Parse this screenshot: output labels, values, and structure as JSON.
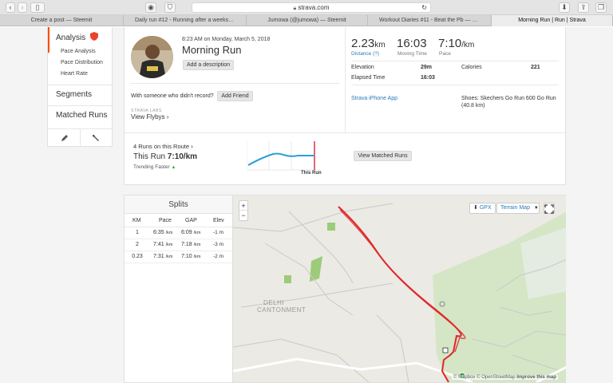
{
  "browser": {
    "url": "strava.com",
    "tabs": [
      {
        "label": "Create a post — Steemit",
        "active": false
      },
      {
        "label": "Daily run #12 - Running after a weeks break (#...",
        "active": false
      },
      {
        "label": "Jumowa (@jumowa) — Steemit",
        "active": false
      },
      {
        "label": "Workout Diaries #11 - Beat the Pb — Steemit",
        "active": false
      },
      {
        "label": "Morning Run | Run | Strava",
        "active": true
      }
    ]
  },
  "sidebar": {
    "analysis_label": "Analysis",
    "sub_items": [
      "Pace Analysis",
      "Pace Distribution",
      "Heart Rate"
    ],
    "segments_label": "Segments",
    "matched_label": "Matched Runs"
  },
  "activity": {
    "datetime": "8:23 AM on Monday, March 5, 2018",
    "title": "Morning Run",
    "add_description": "Add a description",
    "with_someone": "With someone who didn't record?",
    "add_friend": "Add Friend",
    "strava_labs": "STRAVA LABS",
    "view_flybys": "View Flybys"
  },
  "stats": {
    "distance_value": "2.23",
    "distance_unit": "km",
    "distance_label": "Distance (?)",
    "moving_time_value": "16:03",
    "moving_time_label": "Moving Time",
    "pace_value": "7:10",
    "pace_unit": "/km",
    "pace_label": "Pace",
    "elevation_label": "Elevation",
    "elevation_value": "29m",
    "calories_label": "Calories",
    "calories_value": "221",
    "elapsed_label": "Elapsed Time",
    "elapsed_value": "16:03",
    "device": "Strava iPhone App",
    "shoes": "Shoes: Skechers Go Run 600 Go Run",
    "shoes_dist": "(40.8 km)"
  },
  "route": {
    "count_label": "4 Runs on this Route",
    "this_run_prefix": "This Run",
    "this_run_pace": "7:10/km",
    "trend": "Trending Faster",
    "chart_label": "This Run",
    "view_matched": "View Matched Runs",
    "trend_color": "#2a9fd8",
    "marker_color": "#d0021b"
  },
  "splits": {
    "title": "Splits",
    "headers": [
      "KM",
      "Pace",
      "GAP",
      "Elev"
    ],
    "rows": [
      {
        "km": "1",
        "pace": "6:35",
        "pace_unit": "/km",
        "gap": "6:09",
        "gap_unit": "/km",
        "elev": "-1 m"
      },
      {
        "km": "2",
        "pace": "7:41",
        "pace_unit": "/km",
        "gap": "7:18",
        "gap_unit": "/km",
        "elev": "-3 m"
      },
      {
        "km": "0.23",
        "pace": "7:31",
        "pace_unit": "/km",
        "gap": "7:10",
        "gap_unit": "/km",
        "elev": "-2 m"
      }
    ]
  },
  "map": {
    "zoom_in": "+",
    "zoom_out": "−",
    "gpx": "GPX",
    "terrain": "Terrain Map",
    "area_label_1": "DELHI",
    "area_label_2": "CANTONMENT",
    "attribution": "© Mapbox © OpenStreetMap",
    "improve": "Improve this map",
    "route_color": "#e0262a",
    "park_color": "#d4e6c6"
  }
}
